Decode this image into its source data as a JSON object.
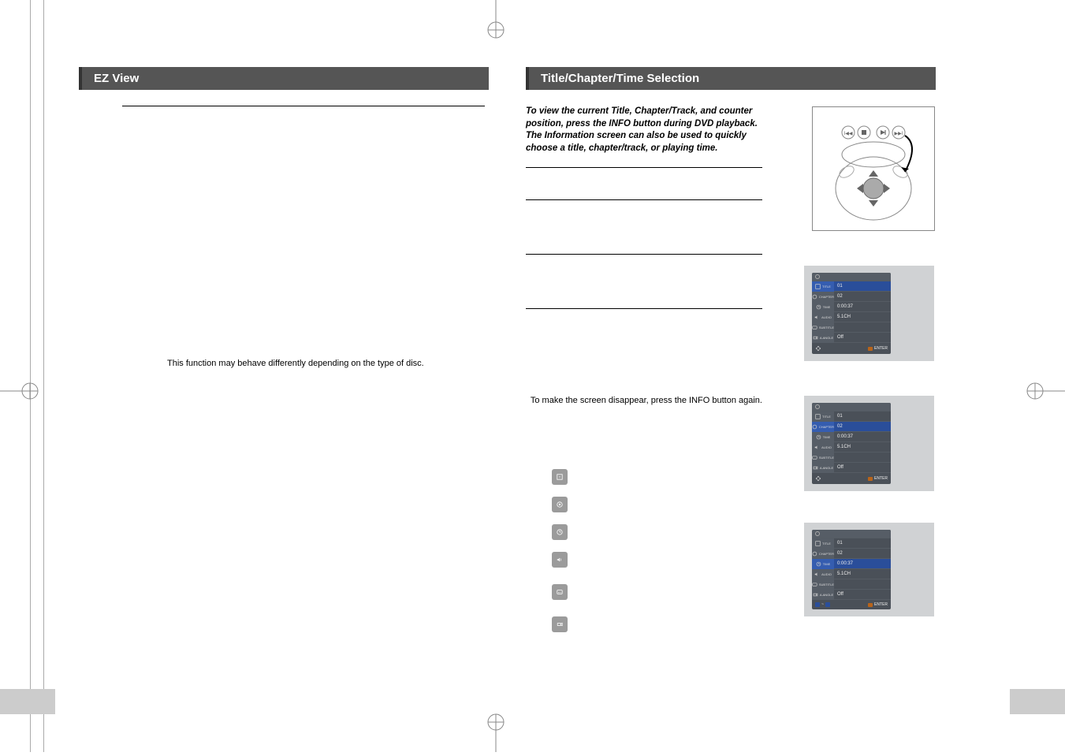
{
  "left_page": {
    "header": "EZ View",
    "note": "This function may behave differently depending on the type of disc."
  },
  "right_page": {
    "header": "Title/Chapter/Time Selection",
    "intro": "To view the current Title, Chapter/Track, and counter position, press the INFO button during DVD playback. The Information screen can also be used to quickly choose a title, chapter/track, or playing time.",
    "disappear_note": "To make the screen disappear, press the INFO button again."
  },
  "icons": {
    "title_icon": "title-icon",
    "chapter_icon": "chapter-icon",
    "time_icon": "time-icon",
    "audio_icon": "audio-icon",
    "subtitle_icon": "subtitle-icon",
    "angle_icon": "angle-icon"
  },
  "osd": {
    "panel1": {
      "highlight_index": 0,
      "rows": [
        {
          "label": "TITLE",
          "value": "01"
        },
        {
          "label": "CHAPTER",
          "value": "02"
        },
        {
          "label": "TIME",
          "value": "0:00:37"
        },
        {
          "label": "AUDIO",
          "value": "5.1CH"
        },
        {
          "label": "SUBTITLE",
          "value": ""
        },
        {
          "label": "A.ANGLE",
          "value": "Off"
        }
      ],
      "footer_left": "",
      "footer_right": "ENTER"
    },
    "panel2": {
      "highlight_index": 1,
      "rows": [
        {
          "label": "TITLE",
          "value": "01"
        },
        {
          "label": "CHAPTER",
          "value": "02"
        },
        {
          "label": "TIME",
          "value": "0:00:37"
        },
        {
          "label": "AUDIO",
          "value": "5.1CH"
        },
        {
          "label": "SUBTITLE",
          "value": ""
        },
        {
          "label": "A.ANGLE",
          "value": "Off"
        }
      ],
      "footer_left": "",
      "footer_right": "ENTER"
    },
    "panel3": {
      "highlight_index": 2,
      "rows": [
        {
          "label": "TITLE",
          "value": "01"
        },
        {
          "label": "CHAPTER",
          "value": "02"
        },
        {
          "label": "TIME",
          "value": "0:00:37"
        },
        {
          "label": "AUDIO",
          "value": "5.1CH"
        },
        {
          "label": "SUBTITLE",
          "value": ""
        },
        {
          "label": "A.ANGLE",
          "value": "Off"
        }
      ],
      "footer_left": "",
      "footer_right": "ENTER"
    }
  }
}
